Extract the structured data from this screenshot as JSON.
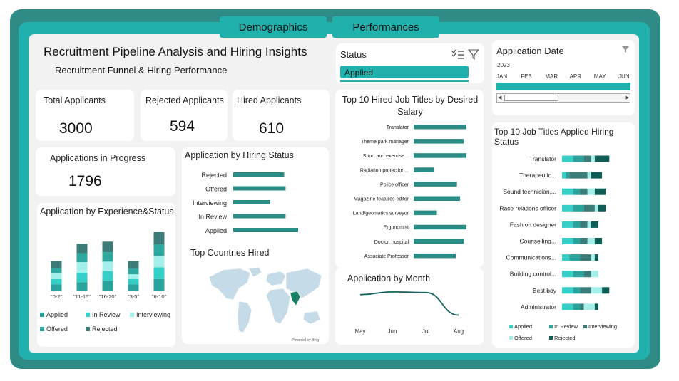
{
  "tabs": [
    "Demographics",
    "Performances"
  ],
  "header": {
    "title": "Recruitment Pipeline Analysis and Hiring Insights",
    "subtitle": "Recruitment Funnel & Hiring Performance"
  },
  "kpis": {
    "total": {
      "label": "Total Applicants",
      "value": "3000"
    },
    "rejected": {
      "label": "Rejected Applicants",
      "value": "594"
    },
    "hired": {
      "label": "Hired Applicants",
      "value": "610"
    },
    "progress": {
      "label": "Applications in Progress",
      "value": "1796"
    }
  },
  "status_slicer": {
    "title": "Status",
    "selected": "Applied"
  },
  "date_slicer": {
    "title": "Application Date",
    "year": "2023",
    "months": [
      "JAN",
      "FEB",
      "MAR",
      "APR",
      "MAY",
      "JUN"
    ]
  },
  "colors": {
    "applied": "#2aa39d",
    "in_review": "#35cfc7",
    "interviewing": "#a4efea",
    "offered": "#2ea89f",
    "rejected": "#3c7c78",
    "hired": "#0e5e55",
    "bar": "#2a8c85",
    "line": "#16625c"
  },
  "chart_data": [
    {
      "id": "experience",
      "type": "bar",
      "title": "Application by Experience&Status",
      "categories": [
        "\"0-2\"",
        "\"11-15\"",
        "\"16-20\"",
        "\"3-5\"",
        "\"6-10\""
      ],
      "stacked": true,
      "series": [
        {
          "name": "Applied",
          "values": [
            60,
            80,
            90,
            60,
            110
          ]
        },
        {
          "name": "In Review",
          "values": [
            50,
            90,
            95,
            50,
            110
          ]
        },
        {
          "name": "Interviewing",
          "values": [
            55,
            100,
            90,
            45,
            110
          ]
        },
        {
          "name": "Offered",
          "values": [
            50,
            85,
            90,
            55,
            110
          ]
        },
        {
          "name": "Rejected",
          "values": [
            65,
            90,
            100,
            70,
            115
          ]
        }
      ],
      "legend": "bottom"
    },
    {
      "id": "hiring_status",
      "type": "bar",
      "orientation": "horizontal",
      "title": "Application by Hiring Status",
      "categories": [
        "Rejected",
        "Offered",
        "Interviewing",
        "In Review",
        "Applied"
      ],
      "values": [
        594,
        610,
        430,
        610,
        756
      ]
    },
    {
      "id": "top_hired",
      "type": "bar",
      "orientation": "horizontal",
      "title": "Top 10 Hired Job Titles by Desired Salary",
      "categories": [
        "Translator",
        "Theme park manager",
        "Sport and exercise...",
        "Radiation protection...",
        "Police officer",
        "Magazine features editor",
        "Land/geomatics surveyor",
        "Ergonomist",
        "Doctor, hospital",
        "Associate Professor"
      ],
      "values": [
        100,
        95,
        100,
        38,
        82,
        88,
        44,
        100,
        95,
        80
      ]
    },
    {
      "id": "by_month",
      "type": "line",
      "title": "Application by Month",
      "categories": [
        "May",
        "Jun",
        "Jul",
        "Aug"
      ],
      "values": [
        920,
        960,
        950,
        620
      ]
    },
    {
      "id": "top_applied",
      "type": "bar",
      "orientation": "horizontal",
      "stacked": true,
      "title": "Top 10 Job Titles Applied Hiring Status",
      "categories": [
        "Translator",
        "Therapeutic...",
        "Sound technician,...",
        "Race relations officer",
        "Fashion designer",
        "Counselling...",
        "Communications...",
        "Building control...",
        "Best boy",
        "Administrator"
      ],
      "series": [
        {
          "name": "Applied",
          "values": [
            3,
            1,
            3,
            3,
            3,
            3,
            2,
            3,
            3,
            3
          ]
        },
        {
          "name": "In Review",
          "values": [
            3,
            1,
            2,
            3,
            2,
            2,
            3,
            3,
            2,
            2
          ]
        },
        {
          "name": "Interviewing",
          "values": [
            2,
            5,
            2,
            3,
            2,
            2,
            3,
            2,
            3,
            1
          ]
        },
        {
          "name": "Offered",
          "values": [
            1,
            1,
            2,
            1,
            1,
            2,
            1,
            2,
            3,
            3
          ]
        },
        {
          "name": "Rejected",
          "values": [
            4,
            3,
            3,
            2,
            2,
            2,
            1,
            0,
            2,
            1
          ]
        }
      ],
      "legend": "bottom"
    },
    {
      "id": "countries",
      "type": "map",
      "title": "Top Countries Hired",
      "highlight": "India",
      "credit": "Powered by Bing"
    }
  ]
}
